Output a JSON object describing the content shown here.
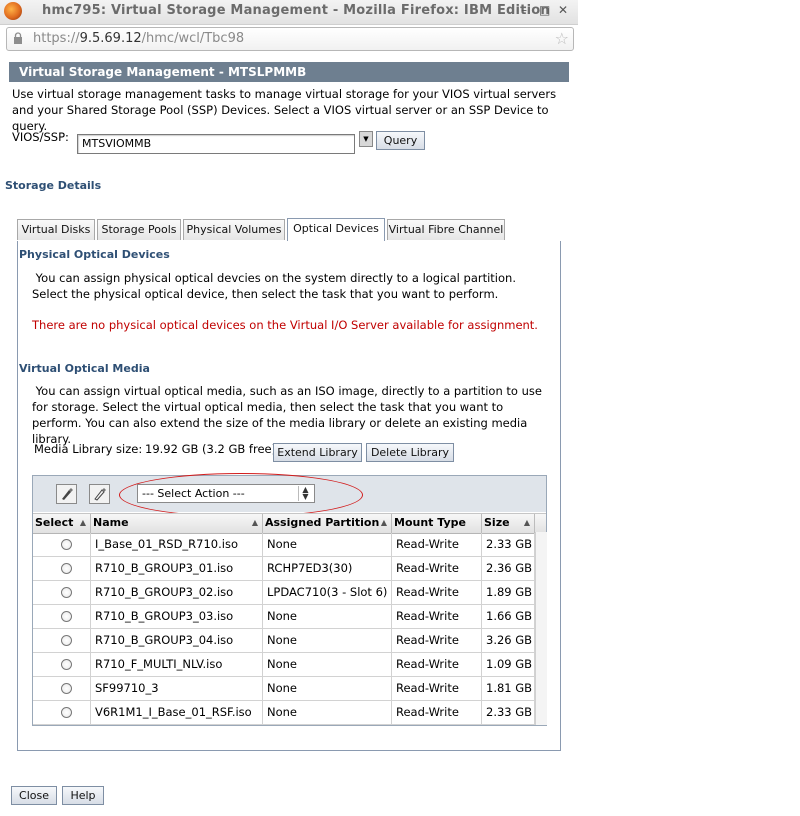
{
  "window": {
    "title": "hmc795: Virtual Storage Management - Mozilla Firefox: IBM Edition",
    "controls": {
      "minimize": "–",
      "maximize": "□",
      "close": "✕"
    }
  },
  "address": {
    "scheme": "https://",
    "host": "9.5.69.12",
    "path": "/hmc/wcl/Tbc98"
  },
  "header": {
    "title": "Virtual Storage Management - MTSLPMMB"
  },
  "intro": "Use virtual storage management tasks to manage virtual storage for your VIOS virtual servers and your Shared Storage Pool (SSP) Devices. Select a VIOS virtual server or an SSP Device to query.",
  "vios": {
    "label": "VIOS/SSP:",
    "value": "MTSVIOMMB",
    "query_label": "Query"
  },
  "storage_details": "Storage Details",
  "tabs": [
    {
      "label": "Virtual Disks",
      "active": false
    },
    {
      "label": "Storage Pools",
      "active": false
    },
    {
      "label": "Physical Volumes",
      "active": false
    },
    {
      "label": "Optical Devices",
      "active": true
    },
    {
      "label": "Virtual Fibre Channel",
      "active": false
    }
  ],
  "physical": {
    "title": "Physical Optical Devices",
    "description": "You can assign physical optical devcies on the system directly to a logical partition. Select the physical optical device, then select the task that you want to perform.",
    "error": "There are no physical optical devices on the Virtual I/O Server available for assignment."
  },
  "virtual": {
    "title": "Virtual Optical Media",
    "description": "You can assign virtual optical media, such as an ISO image, directly to a partition to use for storage. Select the virtual optical media, then select the task that you want to perform. You can also extend the size of the media library or delete an existing media library.",
    "media_library_label": "Media Library size:",
    "media_library_value": "19.92 GB (3.2 GB free)",
    "extend_label": "Extend Library",
    "delete_label": "Delete Library"
  },
  "table": {
    "select_action": "--- Select Action ---",
    "columns": [
      "Select",
      "Name",
      "Assigned Partition",
      "Mount Type",
      "Size"
    ],
    "rows": [
      {
        "name": "I_Base_01_RSD_R710.iso",
        "partition": "None",
        "mount": "Read-Write",
        "size": "2.33 GB"
      },
      {
        "name": "R710_B_GROUP3_01.iso",
        "partition": "RCHP7ED3(30)",
        "mount": "Read-Write",
        "size": "2.36 GB"
      },
      {
        "name": "R710_B_GROUP3_02.iso",
        "partition": "LPDAC710(3 - Slot 6)",
        "mount": "Read-Write",
        "size": "1.89 GB"
      },
      {
        "name": "R710_B_GROUP3_03.iso",
        "partition": "None",
        "mount": "Read-Write",
        "size": "1.66 GB"
      },
      {
        "name": "R710_B_GROUP3_04.iso",
        "partition": "None",
        "mount": "Read-Write",
        "size": "3.26 GB"
      },
      {
        "name": "R710_F_MULTI_NLV.iso",
        "partition": "None",
        "mount": "Read-Write",
        "size": "1.09 GB"
      },
      {
        "name": "SF99710_3",
        "partition": "None",
        "mount": "Read-Write",
        "size": "1.81 GB"
      },
      {
        "name": "V6R1M1_I_Base_01_RSF.iso",
        "partition": "None",
        "mount": "Read-Write",
        "size": "2.33 GB"
      }
    ]
  },
  "footer": {
    "close_label": "Close",
    "help_label": "Help"
  },
  "colors": {
    "header_bg": "#6e7f90",
    "section_title": "#2e4f74",
    "error": "#c00000",
    "annotation": "#d21c1c"
  }
}
